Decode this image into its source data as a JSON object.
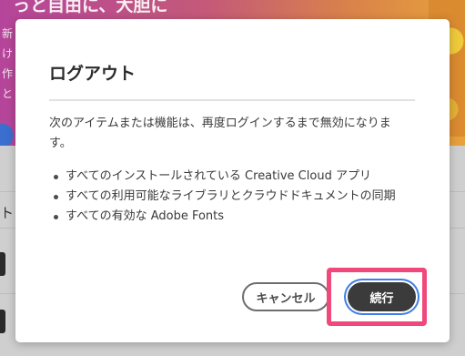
{
  "background": {
    "banner_headline": "っと自由に、大胆に",
    "banner_side_text": "新け作と",
    "tab_label": "ト"
  },
  "dialog": {
    "title": "ログアウト",
    "body": "次のアイテムまたは機能は、再度ログインするまで無効になります。",
    "items": [
      "すべてのインストールされている Creative Cloud アプリ",
      "すべての利用可能なライブラリとクラウドドキュメントの同期",
      "すべての有効な Adobe Fonts"
    ],
    "cancel_label": "キャンセル",
    "continue_label": "続行"
  },
  "colors": {
    "highlight": "#f0487a",
    "focus_ring": "#3f7ee8",
    "primary_button": "#3b3b3b"
  }
}
